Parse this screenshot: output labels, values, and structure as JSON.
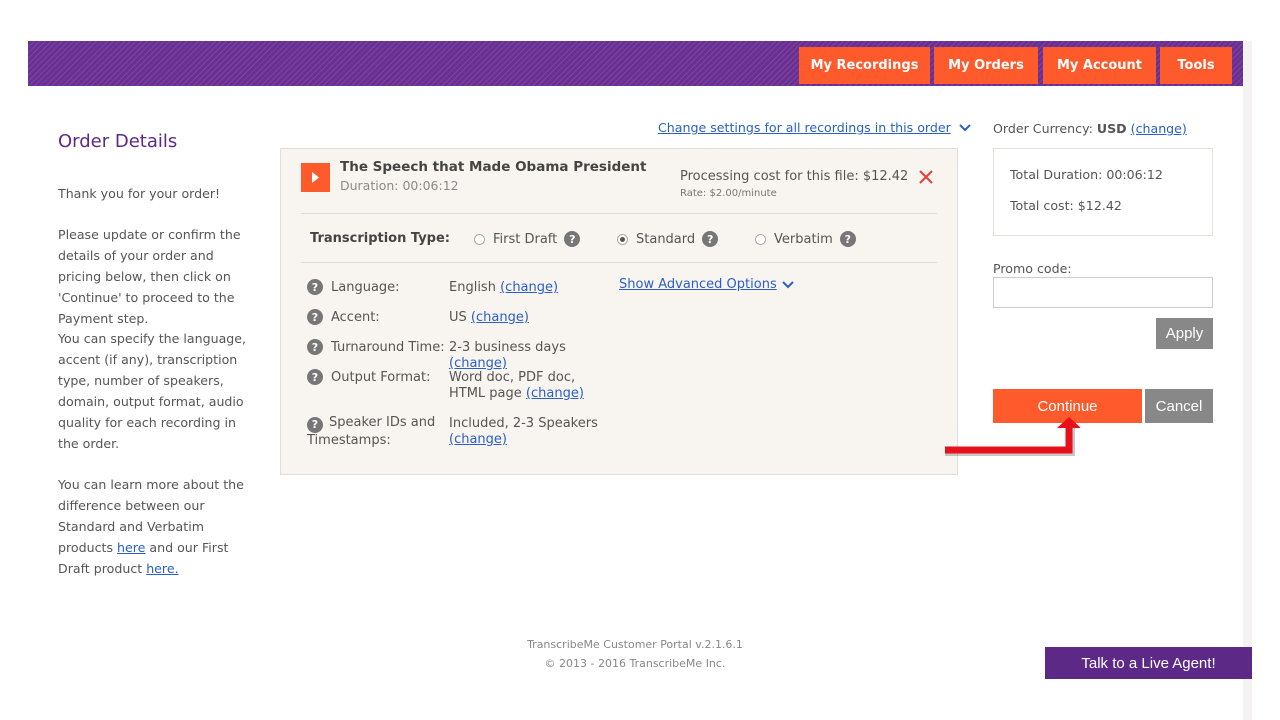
{
  "nav": {
    "my_recordings": "My Recordings",
    "my_orders": "My Orders",
    "my_account": "My Account",
    "tools": "Tools"
  },
  "left": {
    "title": "Order Details",
    "p1": "Thank you for your order!",
    "p2": "Please update or confirm the details of your order and pricing below, then click on 'Continue' to proceed to the Payment step.",
    "p3": "You can specify the language, accent (if any), transcription type, number of speakers, domain, output format, audio quality for each recording in the order.",
    "p4_start": "You can learn more about the difference between our Standard and Verbatim products",
    "here1": "here",
    "p4_mid": " and our First Draft product ",
    "here2": "here."
  },
  "change_all_link": "Change settings for all recordings in this order",
  "file": {
    "title": "The Speech that Made Obama President",
    "duration": "Duration: 00:06:12",
    "cost": "Processing cost for this file: $12.42",
    "rate": "Rate: $2.00/minute"
  },
  "transcription": {
    "label": "Transcription Type:",
    "options": [
      "First Draft",
      "Standard",
      "Verbatim"
    ],
    "selected": "Standard"
  },
  "settings": [
    {
      "label": "Language:",
      "value": "English",
      "change": "(change)"
    },
    {
      "label": "Accent:",
      "value": "US",
      "change": "(change)"
    },
    {
      "label": "Turnaround Time:",
      "value": "2-3 business days",
      "change": "(change)"
    },
    {
      "label": "Output Format:",
      "value": "Word doc, PDF doc, HTML page",
      "change": "(change)"
    },
    {
      "label": "Speaker IDs and Timestamps:",
      "value": "Included, 2-3 Speakers",
      "change": "(change)"
    }
  ],
  "advanced_link": "Show Advanced Options",
  "right": {
    "currency_label": "Order Currency:",
    "currency": "USD",
    "currency_change": "(change)",
    "total_duration": "Total Duration: 00:06:12",
    "total_cost": "Total cost: $12.42",
    "promo_label": "Promo code:",
    "promo_value": "",
    "apply": "Apply",
    "continue": "Continue",
    "cancel": "Cancel"
  },
  "footer": {
    "line1": "TranscribeMe Customer Portal v.2.1.6.1",
    "line2": "© 2013 - 2016 TranscribeMe Inc."
  },
  "live_agent": "Talk to a Live Agent!",
  "colors": {
    "header_purple": "#6a2f93",
    "accent_orange": "#ff5a2b",
    "link_blue": "#2a5fc4",
    "arrow_red": "#e8101a"
  }
}
